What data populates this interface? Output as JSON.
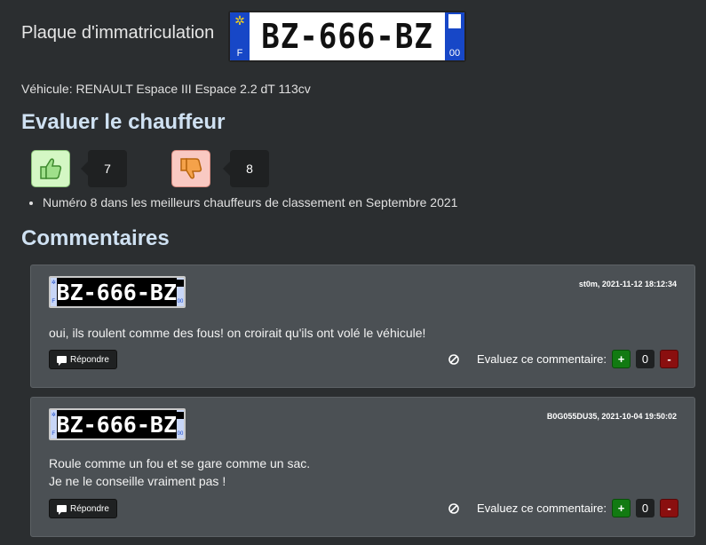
{
  "header": {
    "plate_label": "Plaque d'immatriculation",
    "plate": {
      "number": "BZ-666-BZ",
      "country": "F",
      "department": "00"
    },
    "vehicle": "Véhicule: RENAULT Espace III Espace 2.2 dT 113cv"
  },
  "rating": {
    "heading": "Evaluer le chauffeur",
    "thumb_up_count": "7",
    "thumb_down_count": "8",
    "ranking_items": [
      "Numéro 8 dans les meilleurs chauffeurs de classement en Septembre 2021"
    ]
  },
  "comments": {
    "heading": "Commentaires",
    "items": [
      {
        "plate": {
          "number": "BZ-666-BZ",
          "country": "F",
          "department": "00"
        },
        "meta": "st0m, 2021-11-12 18:12:34",
        "text_lines": [
          "oui, ils roulent comme des fous! on croirait qu'ils ont volé le véhicule!"
        ],
        "reply_label": "Répondre",
        "rate_label": "Evaluez ce commentaire:",
        "plus_label": "+",
        "score": "0",
        "minus_label": "-"
      },
      {
        "plate": {
          "number": "BZ-666-BZ",
          "country": "F",
          "department": "00"
        },
        "meta": "B0G055DU35, 2021-10-04 19:50:02",
        "text_lines": [
          "Roule comme un fou et se gare comme un sac.",
          "Je ne le conseille vraiment pas !"
        ],
        "reply_label": "Répondre",
        "rate_label": "Evaluez ce commentaire:",
        "plus_label": "+",
        "score": "0",
        "minus_label": "-"
      }
    ]
  },
  "colors": {
    "background": "#2b2e30",
    "heading": "#cfe1f2",
    "card": "#4b5054",
    "plate_blue": "#1747c7",
    "thumb_up_bg": "#d4f7c4",
    "thumb_down_bg": "#f9c9c2",
    "vote_plus": "#127a12",
    "vote_minus": "#8a0f0f"
  },
  "icons": [
    "thumbs-up-icon",
    "thumbs-down-icon",
    "speech-bubble-icon",
    "block-icon"
  ]
}
